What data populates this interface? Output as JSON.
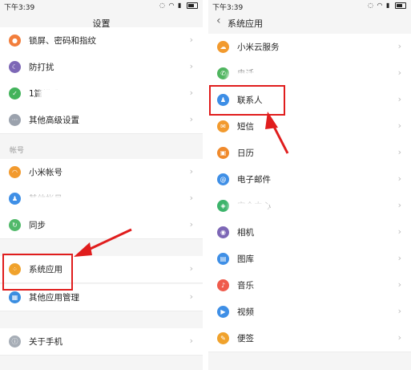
{
  "left": {
    "status_time": "下午3:39",
    "title": "设置",
    "rows_top": [
      {
        "label": "锁屏、密码和指纹",
        "icon": "lock-icon",
        "color": "#f27e3c",
        "glyph": "●"
      },
      {
        "label": "防打扰",
        "icon": "moon-icon",
        "color": "#7d67b6",
        "glyph": "☾"
      },
      {
        "label": "1篇模式",
        "icon": "shield-icon",
        "color": "#42b35b",
        "glyph": "✓"
      },
      {
        "label": "其他高级设置",
        "icon": "more-icon",
        "color": "#9ba2ad",
        "glyph": "···"
      }
    ],
    "section_label": "帐号",
    "rows_account": [
      {
        "label": "小米帐号",
        "icon": "mi-account-icon",
        "color": "#f29a2e",
        "glyph": "◠"
      },
      {
        "label": "其他帐号",
        "icon": "user-icon",
        "color": "#3f8fe6",
        "glyph": "♟"
      },
      {
        "label": "同步",
        "icon": "sync-icon",
        "color": "#51b96a",
        "glyph": "↻"
      }
    ],
    "rows_apps": [
      {
        "label": "系统应用",
        "icon": "system-apps-icon",
        "color": "#f0a22c",
        "glyph": "⁘"
      },
      {
        "label": "其他应用管理",
        "icon": "app-manage-icon",
        "color": "#3a8de0",
        "glyph": "▦"
      }
    ],
    "rows_bottom": [
      {
        "label": "关于手机",
        "icon": "info-icon",
        "color": "#a6adb6",
        "glyph": "ⓘ"
      }
    ]
  },
  "right": {
    "status_time": "下午3:39",
    "title": "系统应用",
    "back_glyph": "‹",
    "rows": [
      {
        "label": "小米云服务",
        "icon": "cloud-icon",
        "color": "#f29a2e",
        "glyph": "☁"
      },
      {
        "label": "电话",
        "icon": "phone-icon",
        "color": "#4fb55f",
        "glyph": "✆"
      },
      {
        "label": "联系人",
        "icon": "contacts-icon",
        "color": "#3d8ee6",
        "glyph": "♟"
      },
      {
        "label": "短信",
        "icon": "sms-icon",
        "color": "#f29a2e",
        "glyph": "✉"
      },
      {
        "label": "日历",
        "icon": "calendar-icon",
        "color": "#f08a2c",
        "glyph": "▣"
      },
      {
        "label": "电子邮件",
        "icon": "email-icon",
        "color": "#3f8fe6",
        "glyph": "@"
      },
      {
        "label": "安全中心",
        "icon": "security-icon",
        "color": "#3cb46b",
        "glyph": "◈"
      },
      {
        "label": "相机",
        "icon": "camera-icon",
        "color": "#7d67b6",
        "glyph": "◉"
      },
      {
        "label": "图库",
        "icon": "gallery-icon",
        "color": "#3f8fe6",
        "glyph": "▤"
      },
      {
        "label": "音乐",
        "icon": "music-icon",
        "color": "#ef5b4c",
        "glyph": "♪"
      },
      {
        "label": "视频",
        "icon": "video-icon",
        "color": "#3f8fe6",
        "glyph": "▶"
      },
      {
        "label": "便签",
        "icon": "notes-icon",
        "color": "#f0a22c",
        "glyph": "✎"
      }
    ]
  },
  "chevron": "›",
  "highlight_color": "#e01d1d"
}
